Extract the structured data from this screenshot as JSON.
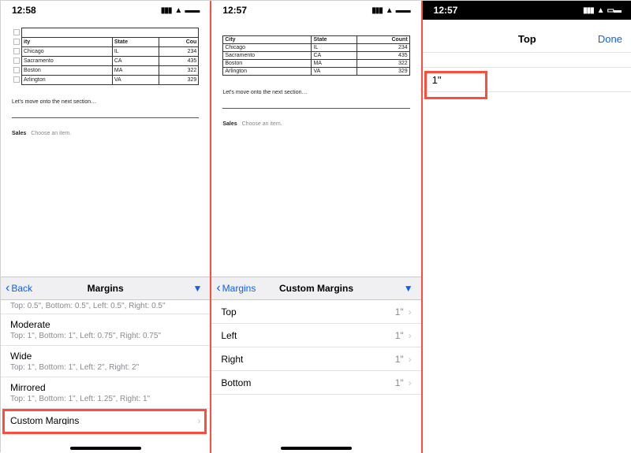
{
  "statusbar": {
    "t1": "12:58",
    "t2": "12:57",
    "t3": "12:57"
  },
  "table1": {
    "head": {
      "city": "ity",
      "state": "State",
      "count": "Cou"
    },
    "rows": [
      {
        "city": "Chicago",
        "state": "IL",
        "count": "234"
      },
      {
        "city": "Sacramento",
        "state": "CA",
        "count": "435"
      },
      {
        "city": "Boston",
        "state": "MA",
        "count": "322"
      },
      {
        "city": "Arlington",
        "state": "VA",
        "count": "329"
      }
    ]
  },
  "table2": {
    "head": {
      "city": "City",
      "state": "State",
      "count": "Count"
    },
    "rows": [
      {
        "city": "Chicago",
        "state": "IL",
        "count": "234"
      },
      {
        "city": "Sacramento",
        "state": "CA",
        "count": "435"
      },
      {
        "city": "Boston",
        "state": "MA",
        "count": "322"
      },
      {
        "city": "Arlington",
        "state": "VA",
        "count": "329"
      }
    ]
  },
  "section_note": "Let's move onto the next section…",
  "sales_label": "Sales",
  "choose_item": "Choose an item.",
  "panel1": {
    "back": "Back",
    "title": "Margins",
    "truncated": "Top: 0.5\", Bottom: 0.5\", Left: 0.5\", Right: 0.5\"",
    "rows": [
      {
        "title": "Moderate",
        "sub": "Top: 1\", Bottom: 1\", Left: 0.75\", Right: 0.75\""
      },
      {
        "title": "Wide",
        "sub": "Top: 1\", Bottom: 1\", Left: 2\", Right: 2\""
      },
      {
        "title": "Mirrored",
        "sub": "Top: 1\", Bottom: 1\", Left: 1.25\", Right: 1\""
      },
      {
        "title": "Custom Margins"
      }
    ]
  },
  "panel2": {
    "back": "Margins",
    "title": "Custom Margins",
    "rows": [
      {
        "title": "Top",
        "val": "1\""
      },
      {
        "title": "Left",
        "val": "1\""
      },
      {
        "title": "Right",
        "val": "1\""
      },
      {
        "title": "Bottom",
        "val": "1\""
      }
    ]
  },
  "panel3": {
    "title": "Top",
    "done": "Done",
    "value": "1\""
  }
}
